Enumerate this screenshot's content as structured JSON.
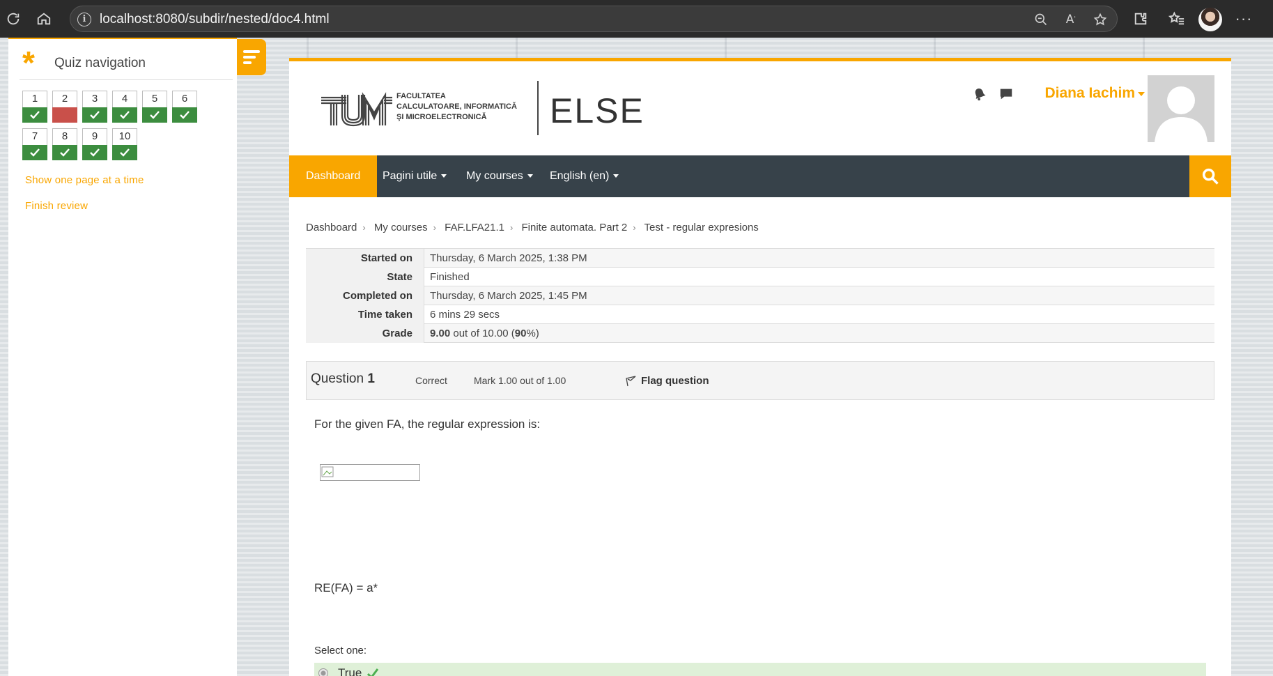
{
  "browser": {
    "url": "localhost:8080/subdir/nested/doc4.html"
  },
  "drawer": {
    "title": "Quiz navigation",
    "questions": [
      {
        "num": "1",
        "status": "correct"
      },
      {
        "num": "2",
        "status": "incorrect"
      },
      {
        "num": "3",
        "status": "correct"
      },
      {
        "num": "4",
        "status": "correct"
      },
      {
        "num": "5",
        "status": "correct"
      },
      {
        "num": "6",
        "status": "correct"
      },
      {
        "num": "7",
        "status": "correct"
      },
      {
        "num": "8",
        "status": "correct"
      },
      {
        "num": "9",
        "status": "correct"
      },
      {
        "num": "10",
        "status": "correct"
      }
    ],
    "show_one_page": "Show one page at a time",
    "finish_review": "Finish review"
  },
  "header": {
    "faculty_line1": "FACULTATEA",
    "faculty_line2": "CALCULATOARE, INFORMATICĂ",
    "faculty_line3": "ŞI MICROELECTRONICĂ",
    "logo_letters": "UTM",
    "site_name": "ELSE",
    "user_name": "Diana Iachim"
  },
  "nav": {
    "dashboard": "Dashboard",
    "pagini": "Pagini utile",
    "courses": "My courses",
    "language": "English (en)"
  },
  "breadcrumb": [
    "Dashboard",
    "My courses",
    "FAF.LFA21.1",
    "Finite automata. Part 2",
    "Test - regular expresions"
  ],
  "summary": {
    "started_label": "Started on",
    "started_value": "Thursday, 6 March 2025, 1:38 PM",
    "state_label": "State",
    "state_value": "Finished",
    "completed_label": "Completed on",
    "completed_value": "Thursday, 6 March 2025, 1:45 PM",
    "time_label": "Time taken",
    "time_value": "6 mins 29 secs",
    "grade_label": "Grade",
    "grade_score": "9.00",
    "grade_mid": " out of 10.00 (",
    "grade_percent": "90",
    "grade_end": "%)"
  },
  "question": {
    "label": "Question",
    "number": "1",
    "state": "Correct",
    "mark": "Mark 1.00 out of 1.00",
    "flag": "Flag question",
    "text": "For the given FA, the regular expression is:",
    "re": "RE(FA) = a*",
    "select_one": "Select one:",
    "answer": "True"
  },
  "colors": {
    "accent": "#f9a600",
    "navbar": "#37424a",
    "correct": "#3c8d3f",
    "incorrect": "#c9504a",
    "answer_bg": "#dff0d8"
  }
}
